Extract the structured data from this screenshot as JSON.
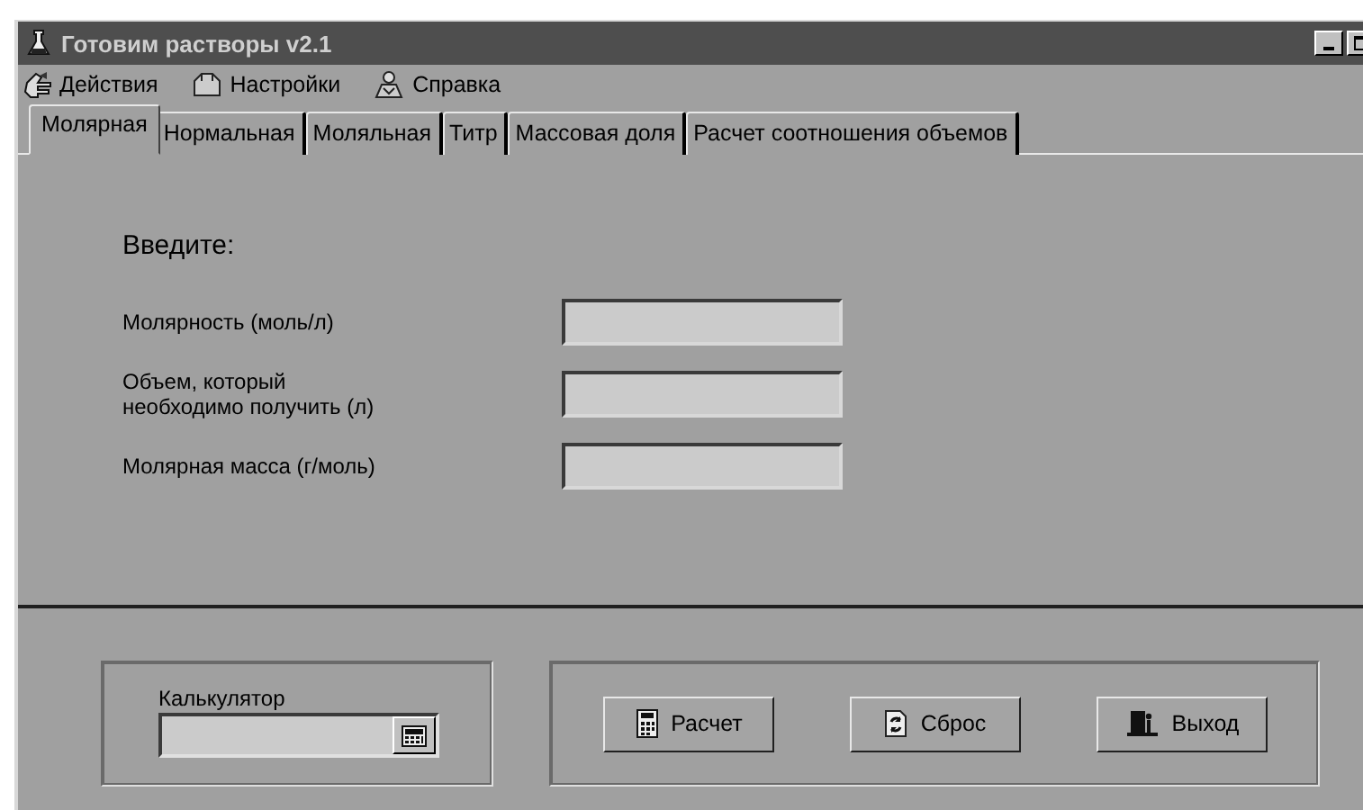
{
  "window": {
    "title": "Готовим растворы v2.1"
  },
  "menu": [
    {
      "label": "Действия"
    },
    {
      "label": "Настройки"
    },
    {
      "label": "Справка"
    }
  ],
  "tabs": [
    {
      "label": "Молярная",
      "selected": true
    },
    {
      "label": "Нормальная",
      "selected": false
    },
    {
      "label": "Моляльная",
      "selected": false
    },
    {
      "label": "Титр",
      "selected": false
    },
    {
      "label": "Массовая доля",
      "selected": false
    },
    {
      "label": "Расчет соотношения объемов",
      "selected": false
    }
  ],
  "form": {
    "heading": "Введите:",
    "fields": [
      {
        "label": "Молярность (моль/л)"
      },
      {
        "label": "Объем, который\nнеобходимо получить (л)"
      },
      {
        "label": "Молярная масса (г/моль)"
      }
    ]
  },
  "calculator": {
    "label": "Калькулятор"
  },
  "buttons": [
    {
      "label": "Расчет"
    },
    {
      "label": "Сброс"
    },
    {
      "label": "Выход"
    }
  ]
}
